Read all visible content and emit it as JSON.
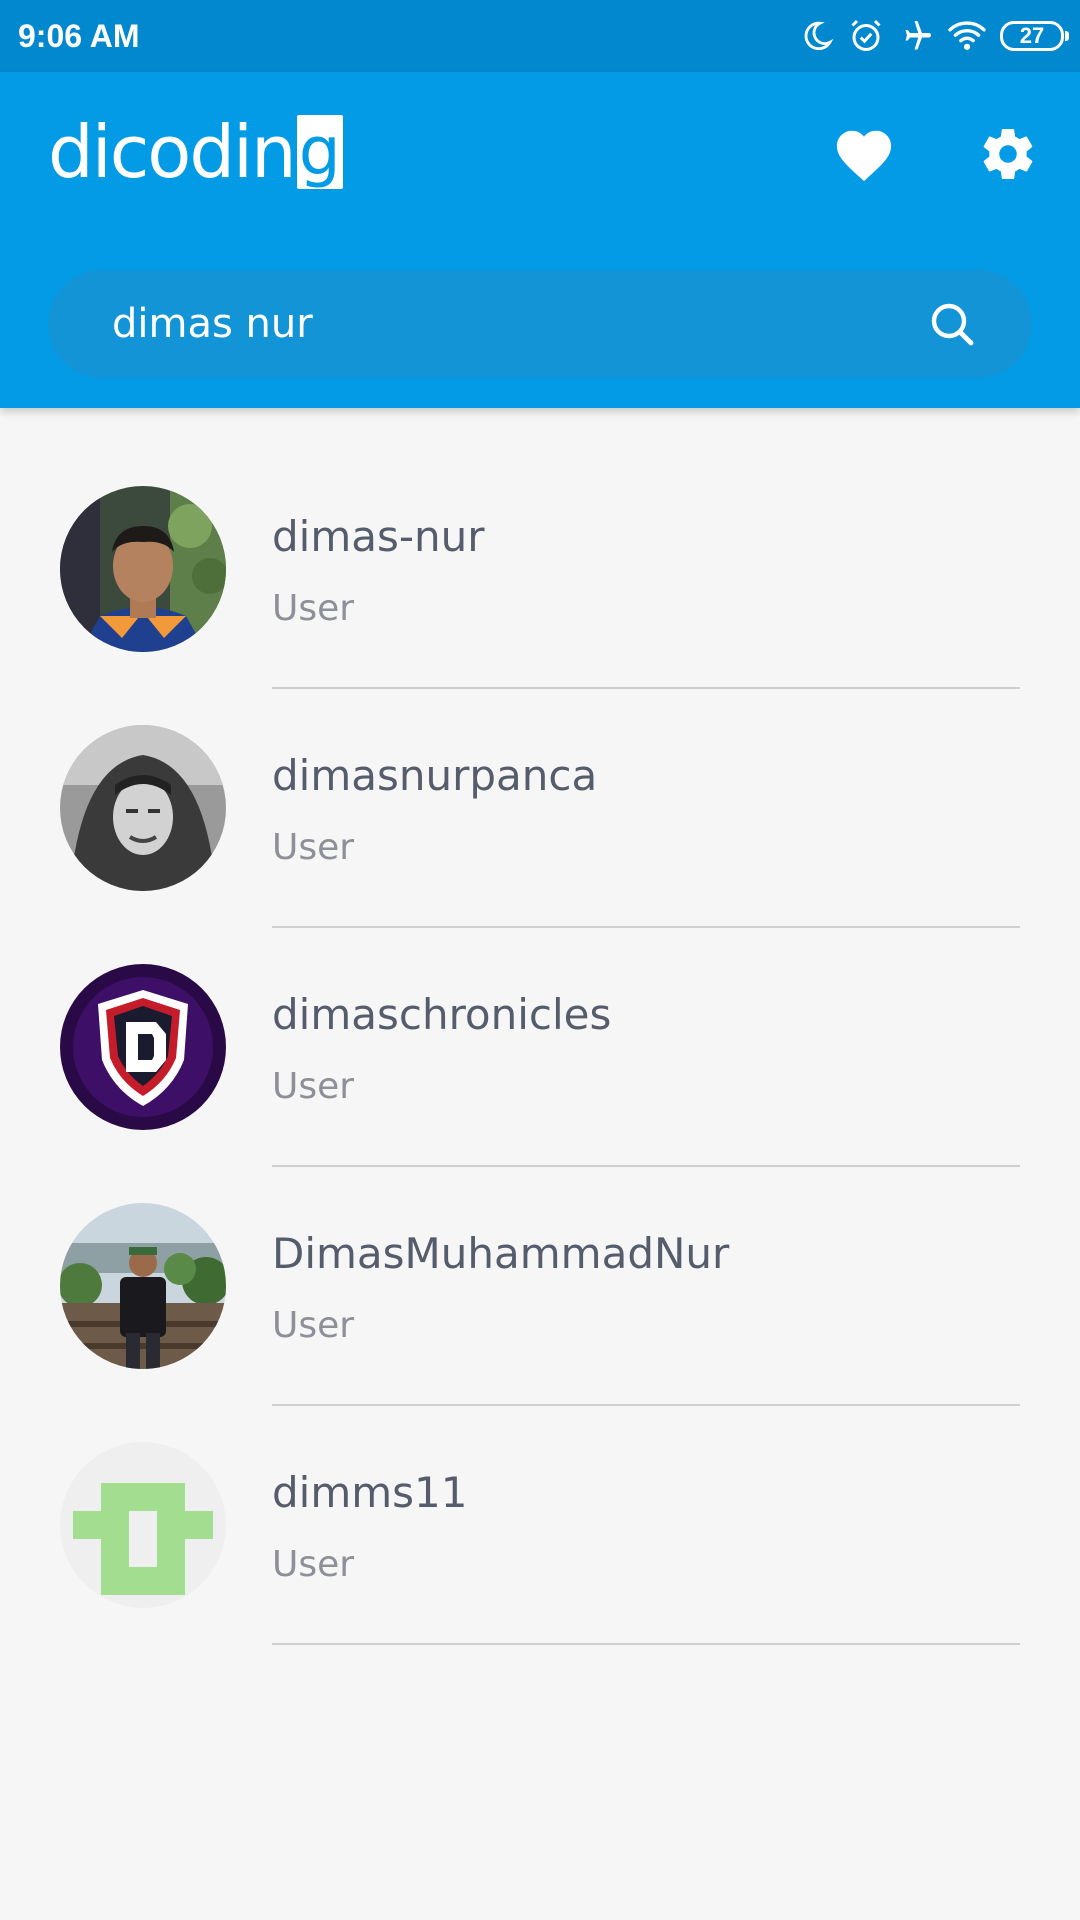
{
  "status_bar": {
    "time": "9:06 AM",
    "battery": "27",
    "icons": [
      "moon-icon",
      "alarm-icon",
      "airplane-icon",
      "wifi-icon",
      "battery-icon"
    ]
  },
  "app_bar": {
    "logo_text": "dicodin",
    "logo_box_letter": "g",
    "favorite_icon": "heart-icon",
    "settings_icon": "gear-icon",
    "background_color": "#039be5"
  },
  "search": {
    "value": "dimas nur",
    "icon": "search-icon"
  },
  "users": [
    {
      "name": "dimas-nur",
      "type": "User"
    },
    {
      "name": "dimasnurpanca",
      "type": "User"
    },
    {
      "name": "dimaschronicles",
      "type": "User"
    },
    {
      "name": "DimasMuhammadNur",
      "type": "User"
    },
    {
      "name": "dimms11",
      "type": "User"
    }
  ]
}
